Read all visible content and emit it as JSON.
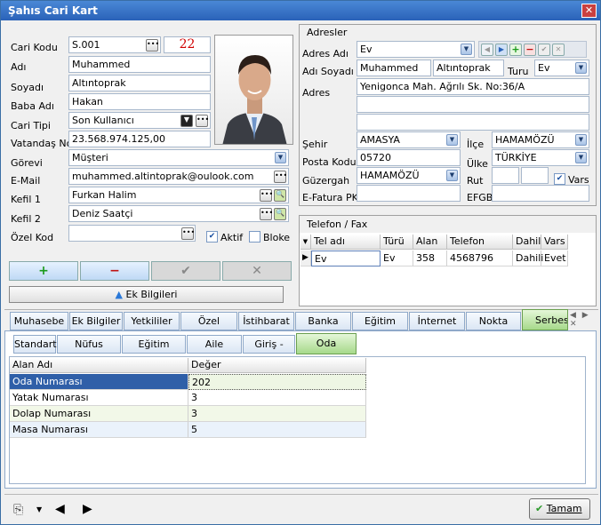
{
  "window": {
    "title": "Şahıs Cari Kart",
    "close": "✕"
  },
  "cari": {
    "labels": {
      "kod": "Cari Kodu",
      "adi": "Adı",
      "soyadi": "Soyadı",
      "baba": "Baba Adı",
      "tipi": "Cari Tipi",
      "tc": "Vatandaş No",
      "gorevi": "Görevi",
      "email": "E-Mail",
      "kefil1": "Kefil 1",
      "kefil2": "Kefil 2",
      "ozelkod": "Özel Kod"
    },
    "values": {
      "kod": "S.001",
      "counter": "22",
      "adi": "Muhammed",
      "soyadi": "Altıntoprak",
      "baba": "Hakan",
      "tipi": "Son Kullanıcı",
      "tc": "23.568.974.125,00",
      "gorevi": "Müşteri",
      "email": "muhammed.altintoprak@oulook.com",
      "kefil1": "Furkan Halim",
      "kefil2": "Deniz Saatçi",
      "ozelkod": ""
    },
    "aktif": "Aktif",
    "bloke": "Bloke",
    "aktif_checked": true,
    "bloke_checked": false,
    "ek_bilgileri": "Ek Bilgileri"
  },
  "adres": {
    "title": "Adresler",
    "labels": {
      "adres_adi": "Adres Adı",
      "adi_soyadi": "Adı Soyadı",
      "turu": "Turu",
      "adres": "Adres",
      "sehir": "Şehir",
      "ilce": "İlçe",
      "posta": "Posta Kodu",
      "ulke": "Ülke",
      "guzergah": "Güzergah",
      "rut": "Rut",
      "vars": "Vars",
      "efatura": "E-Fatura PK",
      "efgb": "EFGB"
    },
    "values": {
      "adres_adi": "Ev",
      "adi": "Muhammed",
      "soyadi": "Altıntoprak",
      "turu": "Ev",
      "adres1": "Yenigonca Mah. Ağrılı Sk. No:36/A",
      "adres2": "",
      "adres3": "",
      "sehir": "AMASYA",
      "ilce": "HAMAMÖZÜ",
      "posta": "05720",
      "ulke": "TÜRKİYE",
      "guzergah": "HAMAMÖZÜ",
      "rut1": "",
      "rut2": "",
      "efatura": "",
      "efgb": ""
    }
  },
  "telefon": {
    "title": "Telefon / Fax",
    "columns": [
      "Tel adı",
      "Türü",
      "Alan",
      "Telefon",
      "Dahili",
      "Vars"
    ],
    "rows": [
      {
        "tel_adi": "Ev",
        "turu": "Ev",
        "alan": "358",
        "telefon": "4568796",
        "dahili": "Dahili",
        "vars": "Evet"
      }
    ]
  },
  "tabs": [
    "Muhasebe",
    "Ek Bilgiler",
    "Yetkililer",
    "Özel Günler",
    "İstihbarat",
    "Banka",
    "Eğitim",
    "İnternet",
    "Nokta",
    "Serbest"
  ],
  "active_tab": "Serbest",
  "subtabs": [
    "Standart",
    "Nüfus Bilgileri",
    "Eğitim Bilgileri",
    "Aile Bilgileri",
    "Giriş - Çıkış",
    "Oda Bilgileri"
  ],
  "active_subtab": "Oda Bilgileri",
  "grid": {
    "columns": [
      "Alan Adı",
      "Değer"
    ],
    "rows": [
      {
        "name": "Oda Numarası",
        "value": "202"
      },
      {
        "name": "Yatak Numarası",
        "value": "3"
      },
      {
        "name": "Dolap Numarası",
        "value": "3"
      },
      {
        "name": "Masa Numarası",
        "value": "5"
      }
    ]
  },
  "footer": {
    "ok": "Tamam"
  },
  "colors": {
    "accent": "#2a62b8",
    "active_tab": "#a6d98a",
    "selected_row": "#2f5fa8",
    "counter": "#d00000"
  }
}
